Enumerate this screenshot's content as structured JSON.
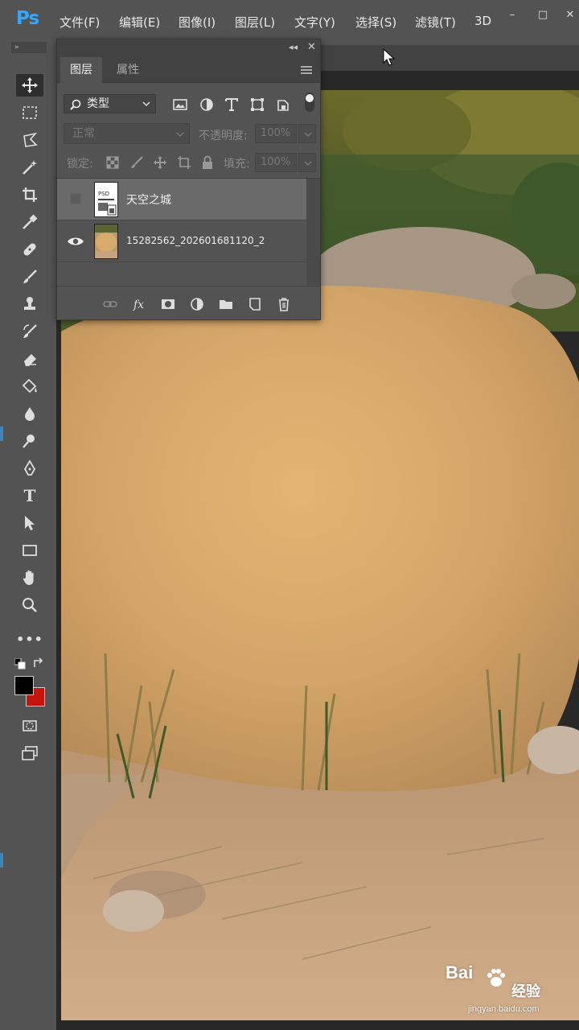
{
  "app": {
    "logo": "Ps",
    "menu": [
      "文件(F)",
      "编辑(E)",
      "图像(I)",
      "图层(L)",
      "文字(Y)",
      "选择(S)",
      "滤镜(T)",
      "3D"
    ],
    "window_controls": [
      "–",
      "□",
      "✕"
    ]
  },
  "toolbar": {
    "collapse_label": "»",
    "tools": [
      {
        "name": "move-tool",
        "icon": "move-icon",
        "active": true
      },
      {
        "name": "marquee-tool",
        "icon": "rect-marquee-icon"
      },
      {
        "name": "lasso-tool",
        "icon": "lasso-icon"
      },
      {
        "name": "magic-wand-tool",
        "icon": "magic-wand-icon"
      },
      {
        "name": "crop-tool",
        "icon": "crop-icon"
      },
      {
        "name": "eyedropper-tool",
        "icon": "eyedropper-icon"
      },
      {
        "name": "healing-brush-tool",
        "icon": "bandage-icon"
      },
      {
        "name": "brush-tool",
        "icon": "brush-icon"
      },
      {
        "name": "clone-stamp-tool",
        "icon": "stamp-icon"
      },
      {
        "name": "history-brush-tool",
        "icon": "history-brush-icon"
      },
      {
        "name": "eraser-tool",
        "icon": "eraser-icon"
      },
      {
        "name": "paint-bucket-tool",
        "icon": "bucket-icon"
      },
      {
        "name": "blur-tool",
        "icon": "drop-icon"
      },
      {
        "name": "dodge-tool",
        "icon": "dodge-icon"
      },
      {
        "name": "pen-tool",
        "icon": "pen-icon"
      },
      {
        "name": "type-tool",
        "icon": "type-icon",
        "text": "T"
      },
      {
        "name": "path-selection-tool",
        "icon": "arrow-icon"
      },
      {
        "name": "rectangle-tool",
        "icon": "rectangle-icon"
      },
      {
        "name": "hand-tool",
        "icon": "hand-icon"
      },
      {
        "name": "zoom-tool",
        "icon": "zoom-icon"
      },
      {
        "name": "more-tools",
        "icon": "more-icon",
        "text": "•••"
      }
    ],
    "foreground_color": "#000000",
    "background_color": "#c4150c"
  },
  "layers_panel": {
    "tabs": [
      "图层",
      "属性"
    ],
    "filter_kind": "类型",
    "blend_mode": "正常",
    "opacity_label": "不透明度:",
    "opacity_value": "100%",
    "lock_label": "锁定:",
    "fill_label": "填充:",
    "fill_value": "100%",
    "layers": [
      {
        "name": "天空之城",
        "visible": false,
        "selected": true,
        "thumb_text": "PSD"
      },
      {
        "name": "15282562_202601681120_2",
        "visible": true,
        "selected": false
      }
    ]
  },
  "watermark": {
    "brand": "Bai",
    "brand2": "经验",
    "url": "jingyan.baidu.com"
  }
}
